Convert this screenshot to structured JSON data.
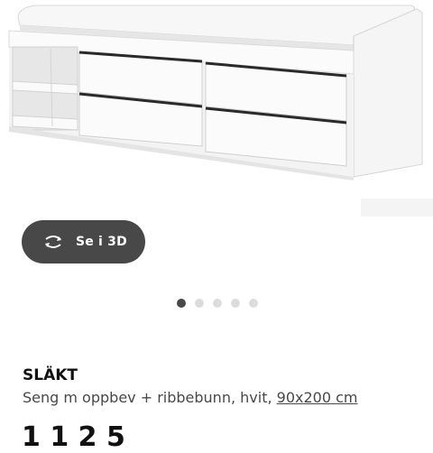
{
  "gallery": {
    "image_subject": "white day bed with storage drawers and open shelves",
    "view_3d": {
      "label": "Se i 3D",
      "icon": "rotate-3d-icon"
    },
    "slides": {
      "count": 5,
      "active_index": 0
    }
  },
  "product": {
    "name": "SLÄKT",
    "description": "Seng m oppbev + ribbebunn, hvit, ",
    "size_link": "90x200 cm",
    "price_partial": "1 1 2 5"
  },
  "colors": {
    "button_bg": "#484848",
    "dot_active": "#484848",
    "dot_inactive": "#dcdcdc",
    "text_primary": "#111111",
    "text_secondary": "#484848"
  }
}
